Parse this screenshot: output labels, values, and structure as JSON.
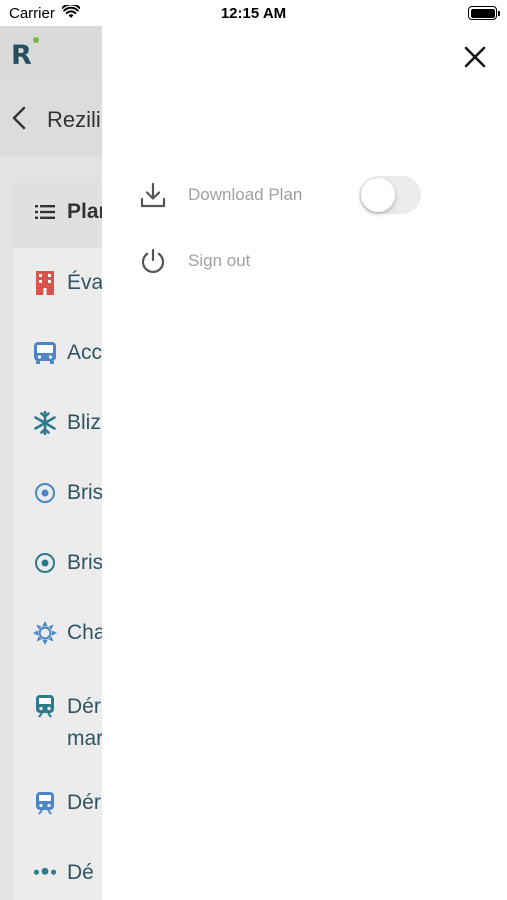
{
  "status_bar": {
    "carrier": "Carrier",
    "time": "12:15 AM",
    "battery_level": 1.0
  },
  "background_app": {
    "logo_letter": "R",
    "brand_colors": {
      "logo": "#26505f",
      "dot": "#7ab648"
    },
    "nav_title": "Rezili",
    "items": [
      {
        "label": "Plan",
        "icon": "list-icon"
      },
      {
        "label": "Évac",
        "icon": "building-icon"
      },
      {
        "label": "Acc",
        "icon": "bus-icon"
      },
      {
        "label": "Bliz",
        "icon": "snowflake-icon"
      },
      {
        "label": "Bris",
        "icon": "target-icon"
      },
      {
        "label": "Bris",
        "icon": "target-icon"
      },
      {
        "label": "Cha",
        "icon": "sun-icon"
      },
      {
        "label_line1": "Dér",
        "label_line2": "mar",
        "icon": "train-icon"
      },
      {
        "label": "Dér",
        "icon": "train-icon"
      },
      {
        "label": "Dé",
        "icon": "people-icon"
      }
    ]
  },
  "drawer": {
    "menu": [
      {
        "label": "Download Plan",
        "icon": "download-icon",
        "toggle_on": false
      },
      {
        "label": "Sign out",
        "icon": "power-icon"
      }
    ]
  }
}
